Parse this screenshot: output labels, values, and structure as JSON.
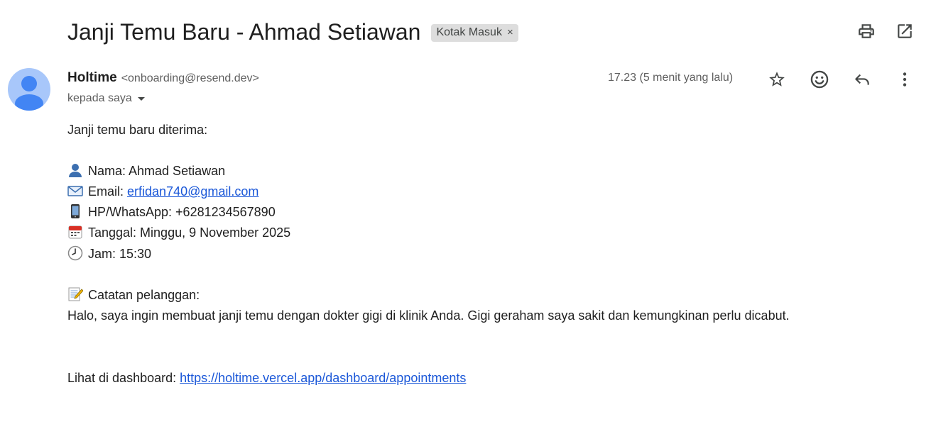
{
  "email": {
    "subject": "Janji Temu Baru - Ahmad Setiawan",
    "label": "Kotak Masuk",
    "label_remove": "×",
    "sender_name": "Holtime",
    "sender_email": "<onboarding@resend.dev>",
    "recipient": "kepada saya",
    "timestamp": "17.23 (5 menit yang lalu)",
    "icons": [
      "print-icon",
      "open-in-new-window-icon",
      "star-icon",
      "emoji-icon",
      "reply-icon",
      "more-vert-icon"
    ]
  },
  "body": {
    "intro": "Janji temu baru diterima:",
    "name_text": "Nama: Ahmad Setiawan",
    "email_label": "Email: ",
    "email_link": "erfidan740@gmail.com",
    "phone_text": "HP/WhatsApp: +6281234567890",
    "date_text": "Tanggal: Minggu, 9 November 2025",
    "time_text": "Jam: 15:30",
    "notes_label": "Catatan pelanggan:",
    "notes_text": "Halo, saya ingin membuat janji temu dengan dokter gigi di klinik Anda. Gigi geraham saya sakit dan kemungkinan perlu dicabut.",
    "dashboard_label": "Lihat di dashboard: ",
    "dashboard_link": "https://holtime.vercel.app/dashboard/appointments"
  },
  "colors": {
    "link": "#1a57d8",
    "avatar_bg": "#a8c7fa",
    "avatar_fg": "#4285f4",
    "chip_bg": "#dddddd"
  }
}
